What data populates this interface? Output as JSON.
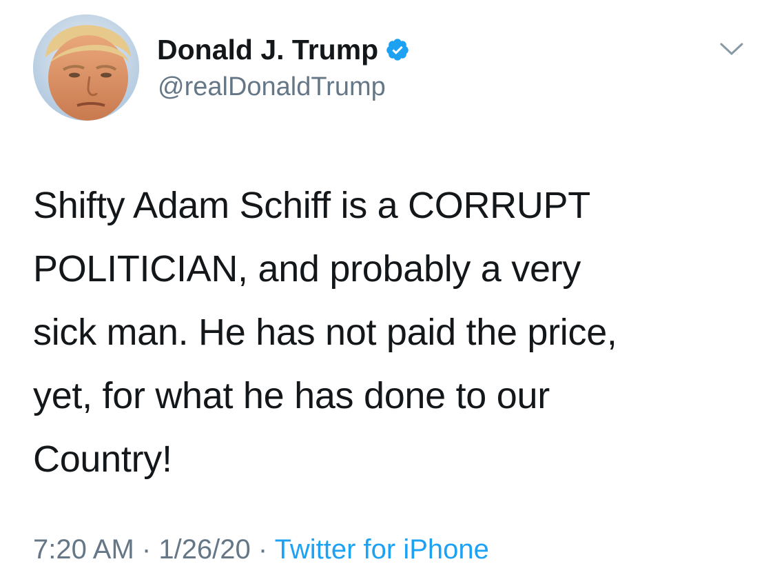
{
  "tweet": {
    "author": {
      "display_name": "Donald J. Trump",
      "handle": "@realDonaldTrump",
      "verified": true,
      "avatar_icon": "profile-photo"
    },
    "menu_icon": "chevron-down-icon",
    "text_lines": [
      "Shifty Adam Schiff is a CORRUPT",
      "POLITICIAN, and probably a very",
      "sick man. He has not paid the price,",
      "yet, for what he has done to our",
      "Country!"
    ],
    "meta": {
      "time": "7:20 AM",
      "separator": "·",
      "date": "1/26/20",
      "source": "Twitter for iPhone"
    }
  },
  "colors": {
    "text": "#14171a",
    "secondary": "#657786",
    "link": "#1da1f2",
    "verified": "#1da1f2",
    "background": "#ffffff"
  }
}
